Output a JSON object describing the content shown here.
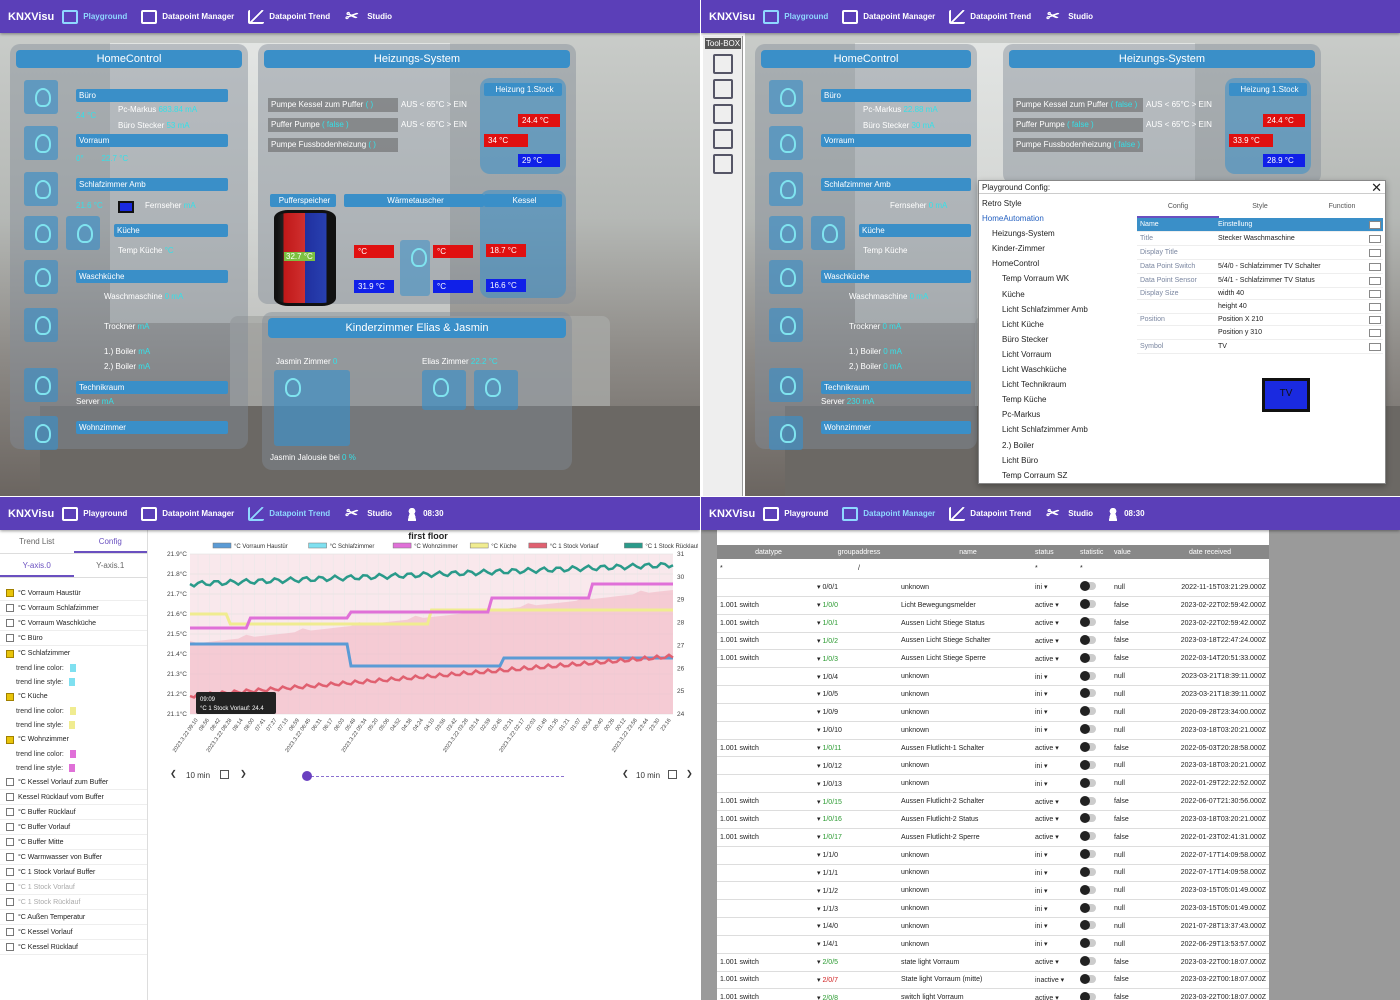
{
  "nav": {
    "brand": "KNXVisu",
    "playground": "Playground",
    "datapoint_manager": "Datapoint Manager",
    "datapoint_trend": "Datapoint Trend",
    "studio": "Studio",
    "time": "08:30"
  },
  "home": {
    "title": "HomeControl",
    "buero": "Büro",
    "pc": "Pc-Markus",
    "pc_val": "683.84 mA",
    "stecker": "Büro Stecker",
    "stecker_val": "53 mA",
    "buero_temp": "24 °C",
    "vorraum": "Vorraum",
    "vorraum_v1": "0°",
    "vorraum_v2": "22.7 °C",
    "schlaf": "Schlafzimmer Amb",
    "schlaf_temp": "21.6 °C",
    "fernseher": "Fernseher",
    "fernseher_val": "mA",
    "kueche": "Küche",
    "temp_kueche": "Temp Küche",
    "temp_kueche_val": "°C",
    "wasch": "Waschküche",
    "waschmaschine": "Waschmaschine",
    "wm_val": "0 mA",
    "trockner": "Trockner",
    "tr_val": "mA",
    "boiler1": "1.) Boiler",
    "b1_val": "mA",
    "boiler2": "2.) Boiler",
    "b2_val": "mA",
    "technik": "Technikraum",
    "server": "Server",
    "server_val": "mA",
    "wohn": "Wohnzimmer"
  },
  "heat": {
    "title": "Heizungs-System",
    "pumpe_kessel": "Pumpe Kessel zum Puffer",
    "pk_val": "( )",
    "aus": "AUS < 65°C > EIN",
    "puffer_pumpe": "Puffer Pumpe",
    "pp_val": "( false )",
    "aus2": "AUS < 65°C > EIN",
    "pumpe_fb": "Pumpe Fussbodenheizung",
    "pf_val": "( )",
    "heizung": "Heizung 1.Stock",
    "h1": "24.4 °C",
    "h2": "34 °C",
    "h3": "29 °C",
    "puffer": "Pufferspeicher",
    "puffer_val": "32.7 °C",
    "puffer_b": "31.9 °C",
    "puffer_r": "°C",
    "waerme": "Wärmetauscher",
    "w_r": "°C",
    "w_b": "°C",
    "kessel": "Kessel",
    "k_r": "18.7 °C",
    "k_b": "16.6 °C"
  },
  "kinder": {
    "title": "Kinderzimmer Elias & Jasmin",
    "jasmin": "Jasmin Zimmer",
    "jasmin_val": "0",
    "elias": "Elias Zimmer",
    "elias_val": "22.2 °C",
    "jalousie": "Jasmin Jalousie bei",
    "jalousie_val": "0 %"
  },
  "studio": {
    "toolbox": "Tool-BOX",
    "config_title": "Playground Config:",
    "close": "✕",
    "pc_val": "22.88 mA",
    "stecker_val": "30 mA",
    "fernseher_val": "0 mA",
    "wm_val": "0 mA",
    "tr_val": "0 mA",
    "b1_val": "0 mA",
    "b2_val": "0 mA",
    "server_val": "230 mA",
    "pk_val": "( false )",
    "pp_val": "( false )",
    "pf_val": "( false )",
    "h1": "24.4 °C",
    "h2": "33.9 °C",
    "h3": "28.9 °C",
    "tree": [
      "Retro Style",
      "HomeAutomation",
      "Heizungs-System",
      "Kinder-Zimmer",
      "HomeControl",
      "Temp Vorraum WK",
      "Küche",
      "Licht Schlafzimmer Amb",
      "Licht Küche",
      "Büro Stecker",
      "Licht Vorraum",
      "Licht Waschküche",
      "Licht Technikraum",
      "Temp Küche",
      "Pc-Markus",
      "Licht Schlafzimmer Amb",
      "2.) Boiler",
      "Licht Büro",
      "Temp Corraum SZ"
    ],
    "tabs": [
      "Config",
      "Style",
      "Function"
    ],
    "head_k": "Name",
    "head_v": "Einstellung",
    "rows": [
      {
        "k": "Title",
        "v": "Stecker Waschmaschine"
      },
      {
        "k": "Display Title",
        "v": ""
      },
      {
        "k": "Data Point Switch",
        "v": "5/4/0 - Schlafzimmer TV Schalter"
      },
      {
        "k": "Data Point Sensor",
        "v": "5/4/1 - Schlafzimmer TV Status"
      },
      {
        "k": "Display Size",
        "v": "width 40"
      },
      {
        "k": "",
        "v": "height 40"
      },
      {
        "k": "Position",
        "v": "Position X 210"
      },
      {
        "k": "",
        "v": "Position y 310"
      },
      {
        "k": "Symbol",
        "v": "TV"
      }
    ],
    "tv": "TV"
  },
  "trend": {
    "tabs": [
      "Trend List",
      "Config"
    ],
    "ytabs": [
      "Y-axis.0",
      "Y-axis.1"
    ],
    "items": [
      {
        "label": "°C Vorraum Haustür",
        "on": true
      },
      {
        "label": "°C Vorraum Schlafzimmer",
        "on": false
      },
      {
        "label": "°C Vorraum Waschküche",
        "on": false
      },
      {
        "label": "°C Büro",
        "on": false
      },
      {
        "label": "°C Schlafzimmer",
        "on": true
      },
      {
        "label": "°C Küche",
        "on": true
      },
      {
        "label": "°C Wohnzimmer",
        "on": true
      },
      {
        "label": "°C Kessel Vorlauf zum Buffer",
        "on": false
      },
      {
        "label": "Kessel Rücklauf vom Buffer",
        "on": false
      },
      {
        "label": "°C Buffer Rücklauf",
        "on": false
      },
      {
        "label": "°C Buffer Vorlauf",
        "on": false
      },
      {
        "label": "°C Buffer Mitte",
        "on": false
      },
      {
        "label": "°C Warmwasser von Buffer",
        "on": false
      },
      {
        "label": "°C 1 Stock Vorlauf Buffer",
        "on": false
      },
      {
        "label": "°C 1 Stock Vorlauf",
        "on": false
      },
      {
        "label": "°C 1 Stock Rücklauf",
        "on": false
      },
      {
        "label": "°C Außen Temperatur",
        "on": false
      },
      {
        "label": "°C Kessel Vorlauf",
        "on": false
      },
      {
        "label": "°C Kessel Rücklauf",
        "on": false
      }
    ],
    "color_label": "trend line color:",
    "style_label": "trend line style:",
    "slider_left": "10 min",
    "slider_right": "10 min",
    "tooltip_time": "09:09",
    "tooltip_text": "°C 1 Stock Vorlauf: 24.4"
  },
  "chart_data": {
    "type": "line",
    "title": "first floor",
    "series": [
      {
        "name": "°C Vorraum Haustür",
        "color": "#5b9bd5"
      },
      {
        "name": "°C Schlafzimmer",
        "color": "#7fe0f0"
      },
      {
        "name": "°C Wohnzimmer",
        "color": "#e070d8"
      },
      {
        "name": "°C Küche",
        "color": "#f0ec90"
      },
      {
        "name": "°C 1 Stock Vorlauf",
        "color": "#e06070"
      },
      {
        "name": "°C 1 Stock Rücklauf",
        "color": "#2a9a8a"
      }
    ],
    "y_left_ticks": [
      "21.9°C",
      "21.8°C",
      "21.7°C",
      "21.6°C",
      "21.5°C",
      "21.4°C",
      "21.3°C",
      "21.2°C",
      "21.1°C"
    ],
    "y_right_ticks": [
      "31",
      "30",
      "29",
      "28",
      "27",
      "26",
      "25",
      "24"
    ],
    "x_ticks": [
      "2023.3.22 09:10",
      "08:56",
      "08:42",
      "2023.3.22 08:28",
      "08:14",
      "08:00",
      "07:41",
      "07:27",
      "07:13",
      "06:59",
      "2023.3.22 06:45",
      "06:31",
      "06:17",
      "06:03",
      "05:48",
      "2023.3.22 05:34",
      "05:20",
      "05:06",
      "04:52",
      "04:38",
      "04:24",
      "04:10",
      "03:56",
      "03:42",
      "2023.3.22 03:28",
      "03:14",
      "02:59",
      "02:45",
      "02:31",
      "2023.3.22 02:17",
      "02:03",
      "01:49",
      "01:35",
      "01:21",
      "01:07",
      "00:54",
      "00:40",
      "00:26",
      "00:12",
      "2023.3.22 23:58",
      "23:44",
      "23:30",
      "23:16"
    ],
    "ylim_left": [
      21.1,
      21.9
    ],
    "ylim_right": [
      24,
      31
    ],
    "grid": true,
    "legend": "top"
  },
  "dp": {
    "headers": [
      "datatype",
      "groupaddress",
      "name",
      "status",
      "statistic",
      "value",
      "date received"
    ],
    "filter_star": "*",
    "filter_slash": "/",
    "rows": [
      [
        "",
        "0/0/1",
        "unknown",
        "ini",
        "null",
        "2022-11-15T03:21:29.000Z"
      ],
      [
        "1.001 switch",
        "1/0/0",
        "Licht Bewegungsmelder",
        "active",
        "false",
        "2023-02-22T02:59:42.000Z"
      ],
      [
        "1.001 switch",
        "1/0/1",
        "Aussen Licht Stiege Status",
        "active",
        "false",
        "2023-02-22T02:59:42.000Z"
      ],
      [
        "1.001 switch",
        "1/0/2",
        "Aussen Licht Stiege Schalter",
        "active",
        "false",
        "2023-03-18T22:47:24.000Z"
      ],
      [
        "1.001 switch",
        "1/0/3",
        "Aussen Licht Stiege Sperre",
        "active",
        "false",
        "2022-03-14T20:51:33.000Z"
      ],
      [
        "",
        "1/0/4",
        "unknown",
        "ini",
        "null",
        "2023-03-21T18:39:11.000Z"
      ],
      [
        "",
        "1/0/5",
        "unknown",
        "ini",
        "null",
        "2023-03-21T18:39:11.000Z"
      ],
      [
        "",
        "1/0/9",
        "unknown",
        "ini",
        "null",
        "2020-09-28T23:34:00.000Z"
      ],
      [
        "",
        "1/0/10",
        "unknown",
        "ini",
        "null",
        "2023-03-18T03:20:21.000Z"
      ],
      [
        "1.001 switch",
        "1/0/11",
        "Aussen Flutlicht-1 Schalter",
        "active",
        "false",
        "2022-05-03T20:28:58.000Z"
      ],
      [
        "",
        "1/0/12",
        "unknown",
        "ini",
        "null",
        "2023-03-18T03:20:21.000Z"
      ],
      [
        "",
        "1/0/13",
        "unknown",
        "ini",
        "null",
        "2022-01-29T22:22:52.000Z"
      ],
      [
        "1.001 switch",
        "1/0/15",
        "Aussen Flutlicht-2 Schalter",
        "active",
        "false",
        "2022-06-07T21:30:56.000Z"
      ],
      [
        "1.001 switch",
        "1/0/16",
        "Aussen Flutlicht-2 Status",
        "active",
        "false",
        "2023-03-18T03:20:21.000Z"
      ],
      [
        "1.001 switch",
        "1/0/17",
        "Aussen Flutlicht-2 Sperre",
        "active",
        "false",
        "2022-01-23T02:41:31.000Z"
      ],
      [
        "",
        "1/1/0",
        "unknown",
        "ini",
        "null",
        "2022-07-17T14:09:58.000Z"
      ],
      [
        "",
        "1/1/1",
        "unknown",
        "ini",
        "null",
        "2022-07-17T14:09:58.000Z"
      ],
      [
        "",
        "1/1/2",
        "unknown",
        "ini",
        "null",
        "2023-03-15T05:01:49.000Z"
      ],
      [
        "",
        "1/1/3",
        "unknown",
        "ini",
        "null",
        "2023-03-15T05:01:49.000Z"
      ],
      [
        "",
        "1/4/0",
        "unknown",
        "ini",
        "null",
        "2021-07-28T13:37:43.000Z"
      ],
      [
        "",
        "1/4/1",
        "unknown",
        "ini",
        "null",
        "2022-06-29T13:53:57.000Z"
      ],
      [
        "1.001 switch",
        "2/0/5",
        "state light Vorraum",
        "active",
        "false",
        "2023-03-22T00:18:07.000Z"
      ],
      [
        "1.001 switch",
        "2/0/7",
        "State light Vorraum (mitte)",
        "inactive",
        "false",
        "2023-03-22T00:18:07.000Z"
      ],
      [
        "1.001 switch",
        "2/0/8",
        "switch light Vorraum",
        "active",
        "false",
        "2023-03-22T00:18:07.000Z"
      ]
    ]
  }
}
